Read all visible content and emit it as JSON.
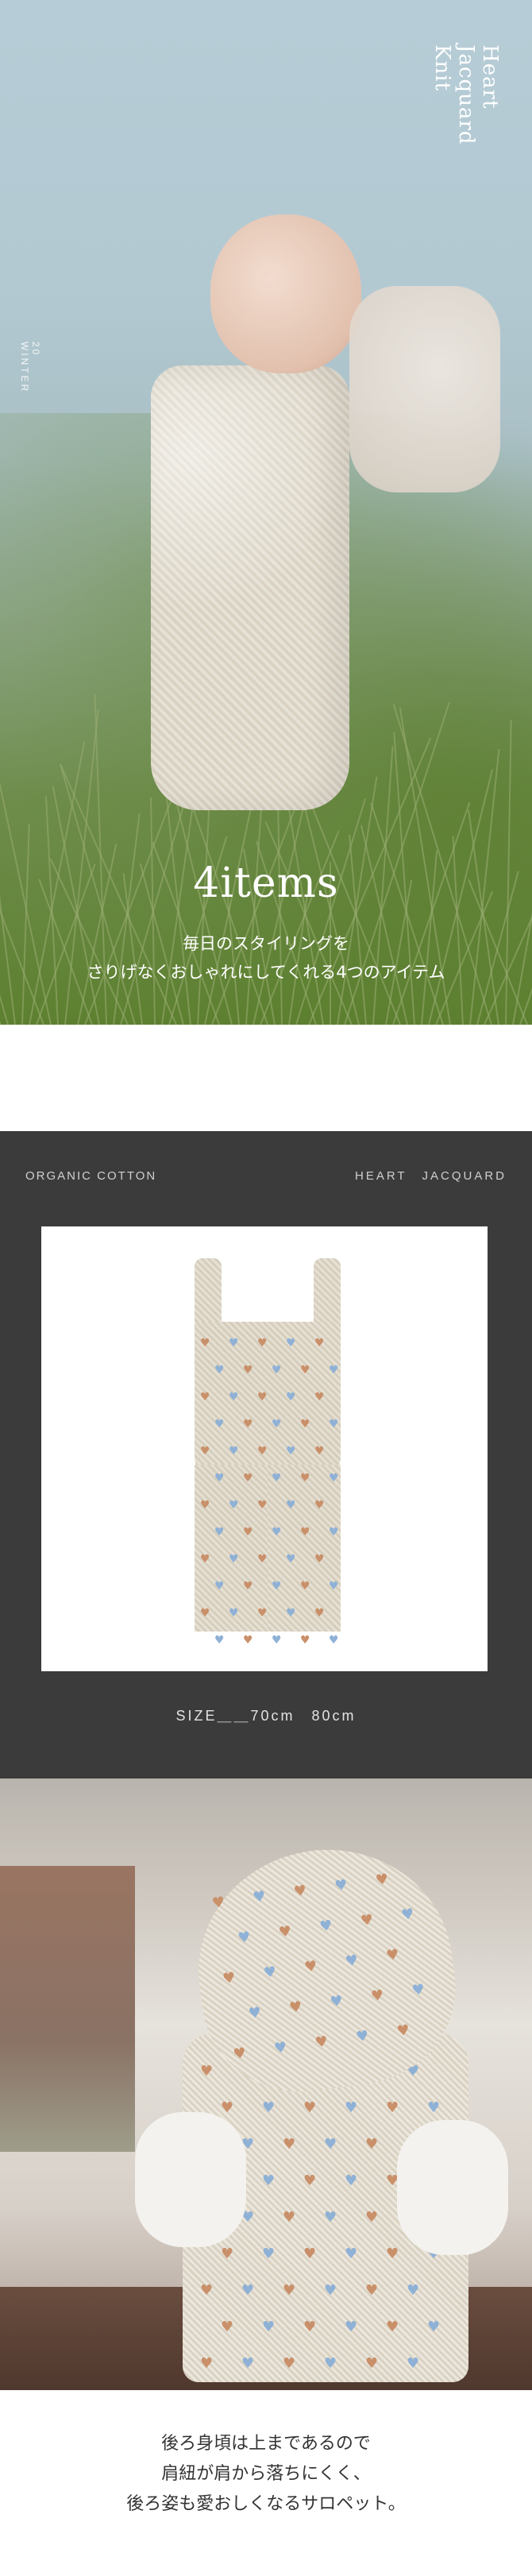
{
  "hero": {
    "brand_lines": [
      "Heart",
      "Jacquard",
      "Knit"
    ],
    "side_year": "20",
    "side_season": "WINTER",
    "title": "4items",
    "subtitle_lines": [
      "毎日のスタイリングを",
      "さりげなくおしゃれにしてくれる4つのアイテム"
    ]
  },
  "product": {
    "label_left": "ORGANIC COTTON",
    "label_right": "HEART JACQUARD",
    "size_text": "SIZE＿＿70cm　80cm",
    "heart_colors": [
      "#c9906a",
      "#8fb1d6"
    ],
    "background_color": "#3b3b3b"
  },
  "detail": {
    "caption_lines": [
      "後ろ身頃は上まであるので",
      "肩紐が肩から落ちにくく、",
      "後ろ姿も愛おしくなるサロペット。"
    ]
  }
}
